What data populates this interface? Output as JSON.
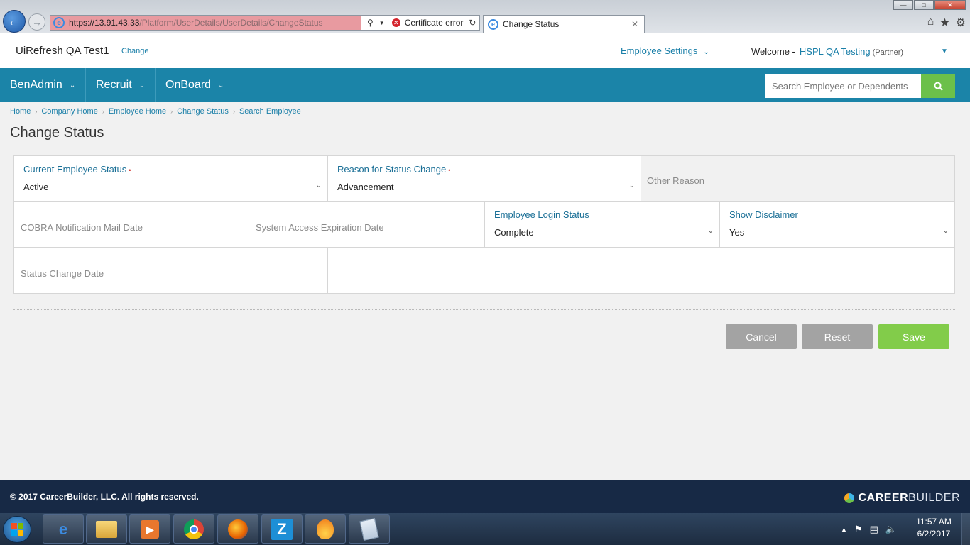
{
  "browser": {
    "url_host": "https://13.91.43.33",
    "url_path": "/Platform/UserDetails/UserDetails/ChangeStatus",
    "cert_error": "Certificate error",
    "tab_title": "Change Status"
  },
  "header": {
    "app_name": "UiRefresh QA Test1",
    "change_link": "Change",
    "employee_settings": "Employee Settings",
    "welcome_label": "Welcome -",
    "user_name": "HSPL QA Testing",
    "user_role": "(Partner)"
  },
  "nav": {
    "items": [
      {
        "label": "BenAdmin"
      },
      {
        "label": "Recruit"
      },
      {
        "label": "OnBoard"
      }
    ],
    "search_placeholder": "Search Employee or Dependents"
  },
  "breadcrumb": [
    "Home",
    "Company Home",
    "Employee Home",
    "Change Status",
    "Search Employee"
  ],
  "page_title": "Change Status",
  "form": {
    "current_status": {
      "label": "Current Employee Status",
      "value": "Active",
      "required": true
    },
    "reason": {
      "label": "Reason for Status Change",
      "value": "Advancement",
      "required": true
    },
    "other_reason": {
      "placeholder": "Other Reason"
    },
    "cobra_date": {
      "placeholder": "COBRA Notification Mail Date"
    },
    "system_access_date": {
      "placeholder": "System Access Expiration Date"
    },
    "login_status": {
      "label": "Employee Login Status",
      "value": "Complete"
    },
    "show_disclaimer": {
      "label": "Show Disclaimer",
      "value": "Yes"
    },
    "status_change_date": {
      "placeholder": "Status Change Date"
    }
  },
  "actions": {
    "cancel": "Cancel",
    "reset": "Reset",
    "save": "Save"
  },
  "colors": {
    "nav_bg": "#1b84a8",
    "link": "#1a7fa8",
    "save_green": "#82cc4a",
    "footer_bg": "#172945"
  },
  "footer": {
    "copyright": "© 2017 CareerBuilder, LLC. All rights reserved.",
    "logo_career": "CAREER",
    "logo_builder": "BUILDER"
  },
  "taskbar": {
    "time": "11:57 AM",
    "date": "6/2/2017",
    "apps": [
      "internet-explorer",
      "file-explorer",
      "media-player",
      "chrome",
      "firefox",
      "z-app",
      "flame-app",
      "notepad"
    ]
  }
}
